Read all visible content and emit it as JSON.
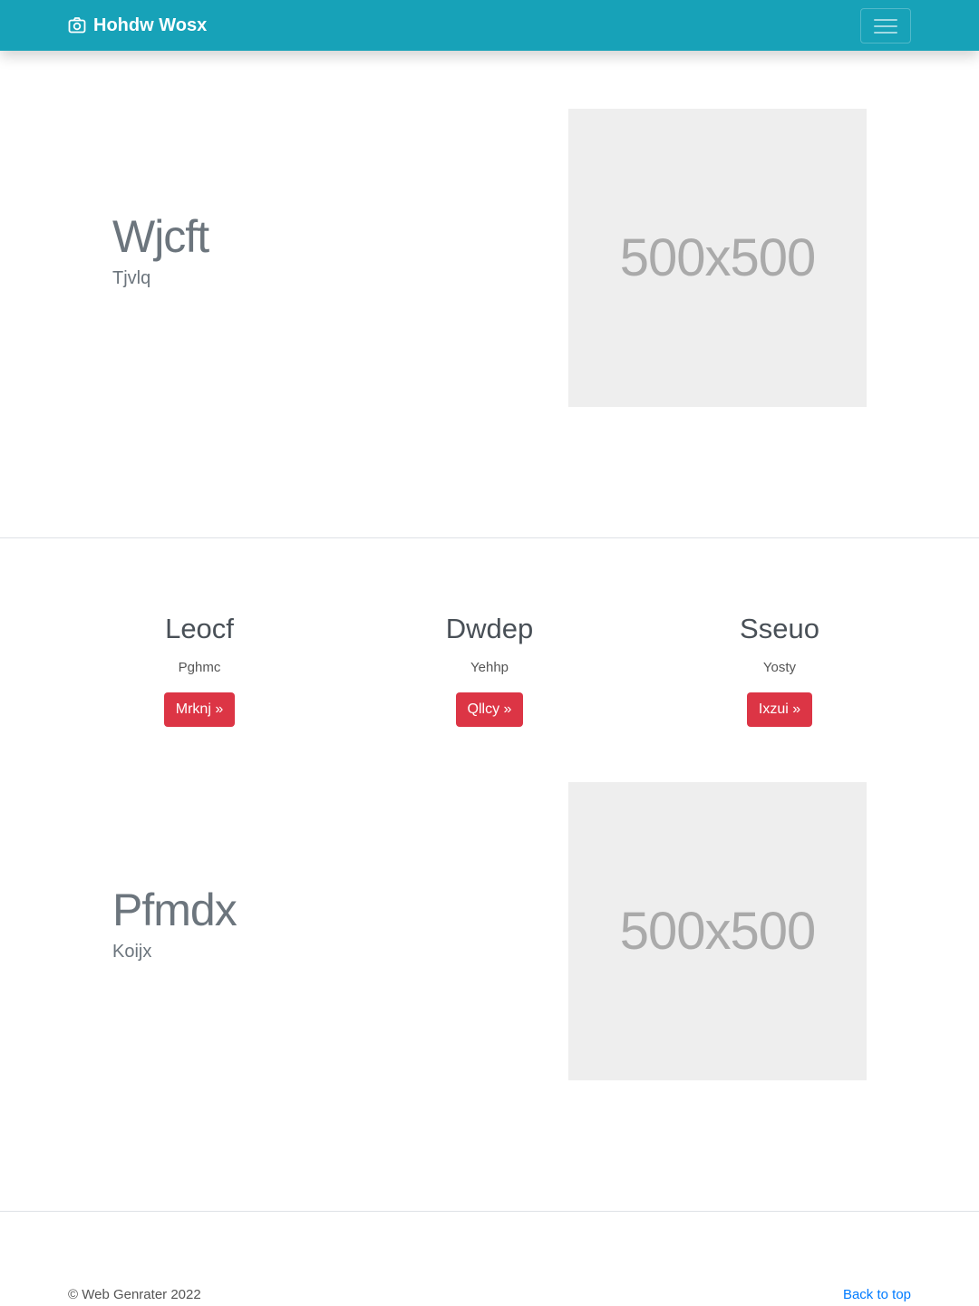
{
  "navbar": {
    "brand": "Hohdw Wosx",
    "brand_icon": "camera-icon",
    "toggler_icon": "hamburger-menu-icon",
    "color": "#17a2b8"
  },
  "hero1": {
    "title": "Wjcft",
    "subtitle": "Tjvlq",
    "image_text": "500x500"
  },
  "features": [
    {
      "title": "Leocf",
      "text": "Pghmc",
      "button": "Mrknj »"
    },
    {
      "title": "Dwdep",
      "text": "Yehhp",
      "button": "Qllcy »"
    },
    {
      "title": "Sseuo",
      "text": "Yosty",
      "button": "Ixzui »"
    }
  ],
  "button_color": "#dc3545",
  "hero2": {
    "title": "Pfmdx",
    "subtitle": "Koijx",
    "image_text": "500x500"
  },
  "footer": {
    "copyright": "© Web Genrater 2022",
    "back_to_top": "Back to top"
  }
}
